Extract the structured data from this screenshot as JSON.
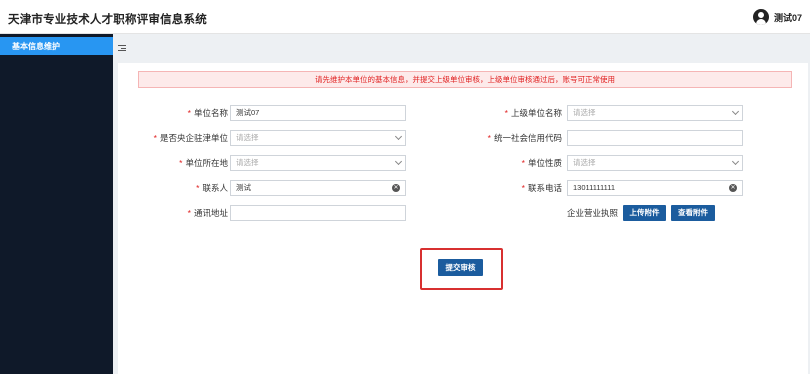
{
  "header": {
    "title": "天津市专业技术人才职称评审信息系统",
    "user_name": "测试07"
  },
  "sidebar": {
    "items": [
      {
        "label": "基本信息维护"
      }
    ]
  },
  "notice": "请先维护本单位的基本信息，并提交上级单位审核，上级单位审核通过后，账号可正常使用",
  "form": {
    "unit_name": {
      "label": "单位名称",
      "required": true,
      "value": "测试07"
    },
    "parent_unit": {
      "label": "上级单位名称",
      "required": true,
      "placeholder": "请选择"
    },
    "is_central": {
      "label": "是否央企驻津单位",
      "required": true,
      "placeholder": "请选择"
    },
    "credit_code": {
      "label": "统一社会信用代码",
      "required": true,
      "value": ""
    },
    "unit_location": {
      "label": "单位所在地",
      "required": true,
      "placeholder": "请选择"
    },
    "unit_nature": {
      "label": "单位性质",
      "required": true,
      "placeholder": "请选择"
    },
    "contact_person": {
      "label": "联系人",
      "required": true,
      "value": "测试"
    },
    "contact_phone": {
      "label": "联系电话",
      "required": true,
      "value": "13011111111"
    },
    "address": {
      "label": "通讯地址",
      "required": true,
      "value": ""
    },
    "business_license": {
      "label": "企业营业执照"
    }
  },
  "buttons": {
    "upload": "上传附件",
    "view": "查看附件",
    "submit": "提交审核"
  },
  "required_mark": "*",
  "colors": {
    "sidebar_bg": "#0f1929",
    "active_item": "#2896f2",
    "primary_button": "#1b5c9e",
    "notice_text": "#e02020",
    "highlight_border": "#d83030"
  }
}
